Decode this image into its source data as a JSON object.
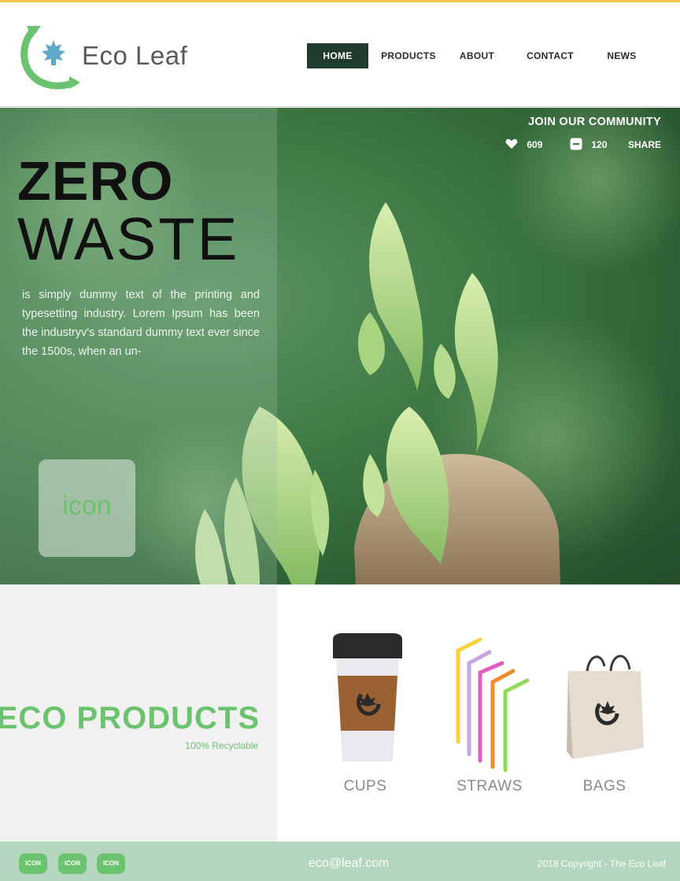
{
  "brand": {
    "name": "Eco Leaf",
    "logo_icon": "leaf-arrow-icon"
  },
  "nav": {
    "items": [
      {
        "label": "HOME",
        "active": true
      },
      {
        "label": "PRODUCTS",
        "active": false
      },
      {
        "label": "ABOUT",
        "active": false
      },
      {
        "label": "CONTACT",
        "active": false
      },
      {
        "label": "NEWS",
        "active": false
      }
    ]
  },
  "community": {
    "title": "JOIN OUR COMMUNITY",
    "likes": "609",
    "comments": "120",
    "share_label": "SHARE"
  },
  "hero": {
    "title_line1": "ZERO",
    "title_line2": "WASTE",
    "description": "is simply dummy text of the printing and typesetting industry. Lorem Ipsum has been the industryv's standard dummy text ever since the 1500s, when an un-",
    "icon_label": "icon"
  },
  "products_section": {
    "title": "ECO PRODUCTS",
    "subtitle": "100% Recyclable",
    "items": [
      {
        "label": "CUPS"
      },
      {
        "label": "STRAWS"
      },
      {
        "label": "BAGS"
      }
    ]
  },
  "footer": {
    "icons": [
      "ICON",
      "ICON",
      "ICON"
    ],
    "email": "eco@leaf.com",
    "copyright": "2018 Copyright - The Eco Leaf"
  },
  "colors": {
    "accent_green": "#6cc36f",
    "nav_active": "#1f3b2d",
    "footer_bg": "#b4d6bf",
    "top_line": "#f2c14e"
  }
}
